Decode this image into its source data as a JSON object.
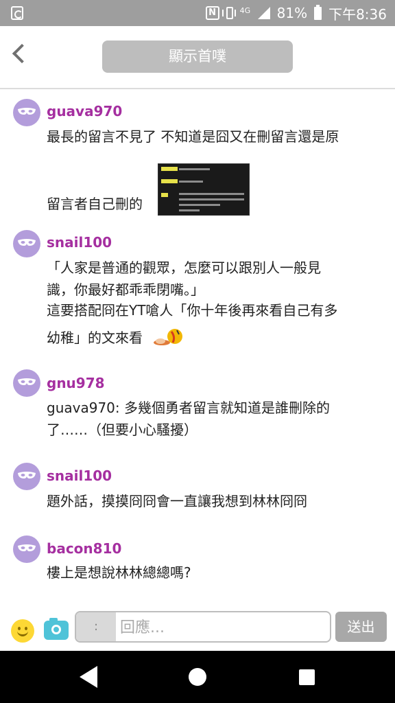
{
  "status_bar": {
    "network": "4G",
    "battery": "81%",
    "time": "下午8:36"
  },
  "header": {
    "title": "顯示首噗"
  },
  "comments": [
    {
      "user": "guava970",
      "lines": [
        "最長的留言不見了 不知道是囧又在刪留言還是原",
        "留言者自己刪的"
      ],
      "has_image": true
    },
    {
      "user": "snail100",
      "lines": [
        "「人家是普通的觀眾，怎麼可以跟別人一般見",
        "識，你最好都乖乖閉嘴。」",
        "這要搭配冏在YT嗆人「你十年後再來看自己有多",
        "幼稚」的文來看"
      ],
      "has_emoji": true
    },
    {
      "user": "gnu978",
      "lines": [
        "guava970: 多幾個勇者留言就知道是誰刪除的",
        "了……（但要小心騷擾）"
      ]
    },
    {
      "user": "snail100",
      "lines": [
        "題外話，摸摸冏冏會一直讓我想到林林冏冏"
      ]
    },
    {
      "user": "bacon810",
      "lines": [
        "樓上是想說林林總總嗎?"
      ]
    }
  ],
  "input_bar": {
    "colon": ":",
    "placeholder": "回應...",
    "send_label": "送出"
  },
  "colors": {
    "username": "#a52fa0",
    "avatar": "#b39ddb",
    "status_bar": "#9e9e9e"
  }
}
